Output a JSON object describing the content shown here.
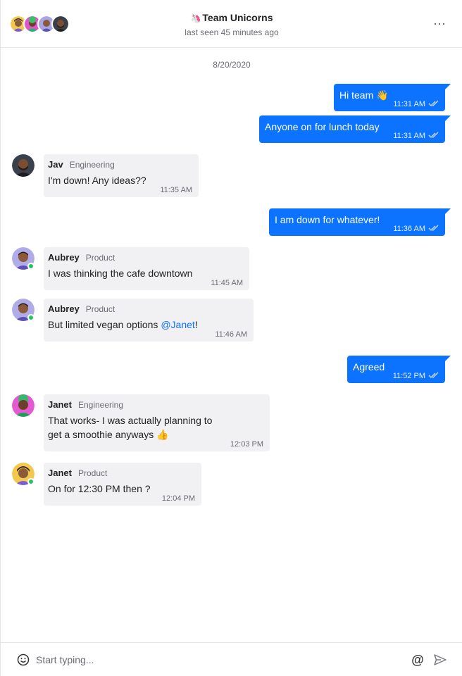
{
  "header": {
    "title_emoji": "🦄",
    "title": "Team Unicorns",
    "subtitle": "last seen 45 minutes ago",
    "more_label": "···"
  },
  "date_separator": "8/20/2020",
  "messages": [
    {
      "text": "Hi team 👋",
      "time": "11:31 AM"
    },
    {
      "text": "Anyone on for lunch today",
      "time": "11:31 AM"
    },
    {
      "name": "Jav",
      "role": "Engineering",
      "text": "I'm down! Any ideas??",
      "time": "11:35 AM"
    },
    {
      "text": "I am down for whatever!",
      "time": "11:36 AM"
    },
    {
      "name": "Aubrey",
      "role": "Product",
      "text": "I was thinking the cafe downtown",
      "time": "11:45 AM"
    },
    {
      "name": "Aubrey",
      "role": "Product",
      "text": "But limited vegan options ",
      "mention": "@Janet",
      "text_after": "!",
      "time": "11:46 AM"
    },
    {
      "text": "Agreed",
      "time": "11:52 PM"
    },
    {
      "name": "Janet",
      "role": "Engineering",
      "text_line1": "That works- I was actually planning to",
      "text_line2": "get a smoothie anyways 👍",
      "time": "12:03 PM"
    },
    {
      "name": "Janet",
      "role": "Product",
      "text": "On for 12:30 PM then ?",
      "time": "12:04 PM"
    }
  ],
  "composer": {
    "placeholder": "Start typing...",
    "at_label": "@"
  },
  "colors": {
    "outgoing_bubble": "#0b73ff",
    "incoming_bubble": "#f1f1f4",
    "online": "#22c55e",
    "mention": "#0b73ff"
  }
}
